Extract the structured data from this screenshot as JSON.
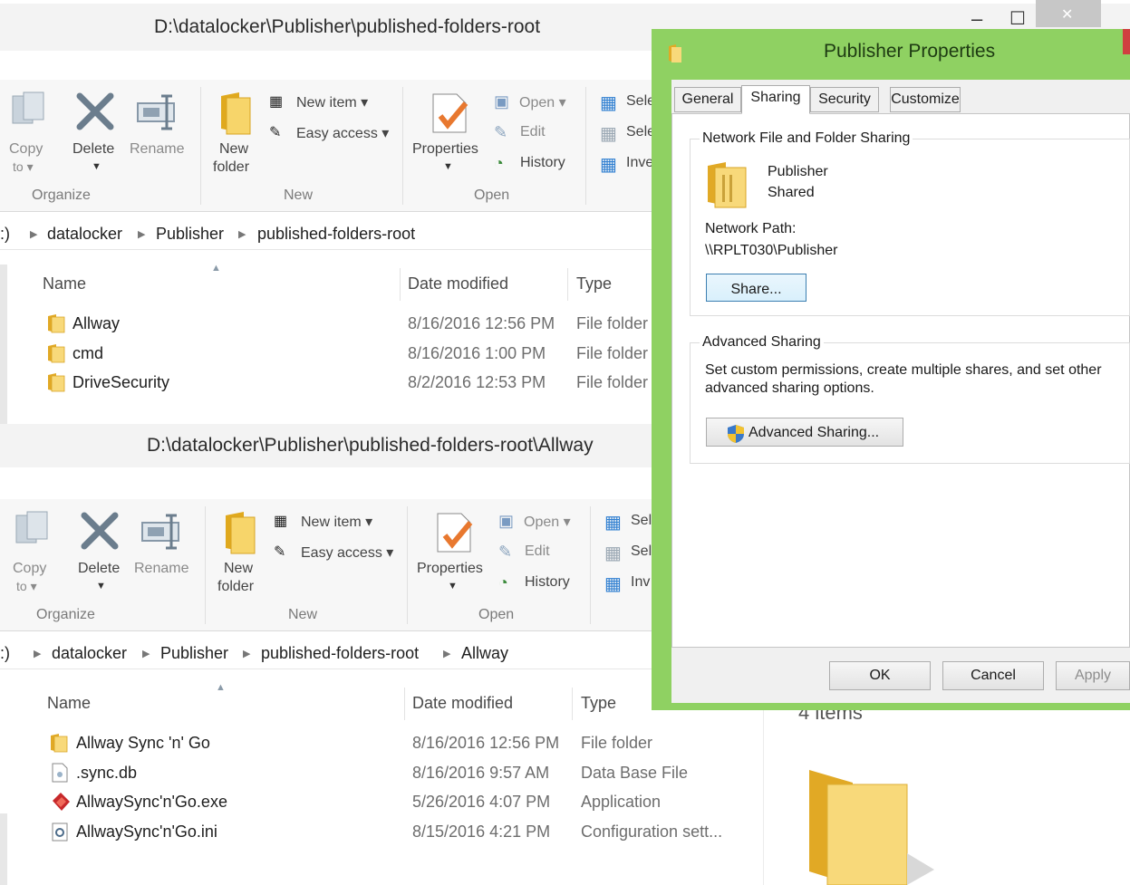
{
  "window1": {
    "title": "D:\\datalocker\\Publisher\\published-folders-root",
    "breadcrumb": [
      ":)",
      "datalocker",
      "Publisher",
      "published-folders-root"
    ],
    "ribbon": {
      "copy": [
        "Copy",
        "to ▾"
      ],
      "delete": "Delete",
      "rename": "Rename",
      "new_folder": [
        "New",
        "folder"
      ],
      "new_item": "New item ▾",
      "easy_access": "Easy access ▾",
      "properties": "Properties",
      "open": "Open ▾",
      "edit": "Edit",
      "history": "History",
      "select_all": "Sele",
      "select_none": "Sele",
      "invert": "Inve",
      "groups": {
        "organize": "Organize",
        "new": "New",
        "open": "Open"
      }
    },
    "columns": {
      "name": "Name",
      "date": "Date modified",
      "type": "Type"
    },
    "rows": [
      {
        "name": "Allway",
        "date": "8/16/2016 12:56 PM",
        "type": "File folder"
      },
      {
        "name": "cmd",
        "date": "8/16/2016 1:00 PM",
        "type": "File folder"
      },
      {
        "name": "DriveSecurity",
        "date": "8/2/2016 12:53 PM",
        "type": "File folder"
      }
    ]
  },
  "window2": {
    "title": "D:\\datalocker\\Publisher\\published-folders-root\\Allway",
    "breadcrumb": [
      ":)",
      "datalocker",
      "Publisher",
      "published-folders-root",
      "Allway"
    ],
    "ribbon": {
      "copy": [
        "Copy",
        "to ▾"
      ],
      "delete": "Delete",
      "rename": "Rename",
      "new_folder": [
        "New",
        "folder"
      ],
      "new_item": "New item ▾",
      "easy_access": "Easy access ▾",
      "properties": "Properties",
      "open": "Open ▾",
      "edit": "Edit",
      "history": "History",
      "select_all": "Sel",
      "select_none": "Sel",
      "invert": "Inv",
      "groups": {
        "organize": "Organize",
        "new": "New",
        "open": "Open"
      }
    },
    "columns": {
      "name": "Name",
      "date": "Date modified",
      "type": "Type"
    },
    "rows": [
      {
        "name": "Allway Sync 'n' Go",
        "date": "8/16/2016 12:56 PM",
        "type": "File folder",
        "icon": "folder-icon"
      },
      {
        "name": ".sync.db",
        "date": "8/16/2016 9:57 AM",
        "type": "Data Base File",
        "icon": "database-file-icon"
      },
      {
        "name": "AllwaySync'n'Go.exe",
        "date": "5/26/2016 4:07 PM",
        "type": "Application",
        "icon": "application-icon"
      },
      {
        "name": "AllwaySync'n'Go.ini",
        "date": "8/15/2016 4:21 PM",
        "type": "Configuration sett...",
        "icon": "config-file-icon"
      }
    ],
    "details_pane": {
      "item_count": "4 items"
    }
  },
  "window_controls": {
    "minimize": "–",
    "maximize": "☐",
    "close": "✕"
  },
  "dialog": {
    "title": "Publisher Properties",
    "tabs": [
      "General",
      "Sharing",
      "Security",
      "Customize"
    ],
    "active_tab": "Sharing",
    "network_sharing": {
      "legend": "Network File and Folder Sharing",
      "folder_name": "Publisher",
      "share_state": "Shared",
      "path_label": "Network Path:",
      "path": "\\\\RPLT030\\Publisher",
      "share_button": "Share..."
    },
    "advanced_sharing": {
      "legend": "Advanced Sharing",
      "description_line1": "Set custom permissions, create multiple shares, and set other",
      "description_line2": "advanced sharing options.",
      "button": "Advanced Sharing..."
    },
    "buttons": {
      "ok": "OK",
      "cancel": "Cancel",
      "apply": "Apply"
    }
  },
  "colors": {
    "dialog_frame": "#8fd162",
    "close_button": "#c7c7c7",
    "folder_yellow": "#f2c94c"
  }
}
